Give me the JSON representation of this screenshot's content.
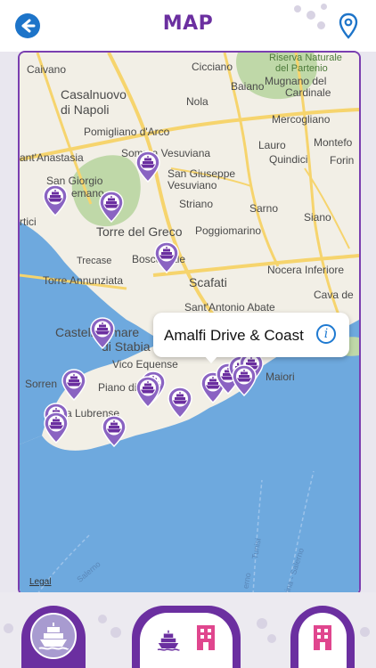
{
  "header": {
    "title": "MAP",
    "back_icon": "back-arrow-icon",
    "location_icon": "location-pin-icon"
  },
  "map": {
    "labels": {
      "caivano": "Caivano",
      "cicciano": "Cicciano",
      "riserva_partenio": "Riserva Naturale",
      "del_partenio": "del Partenio",
      "mugnano": "Mugnano del",
      "cardinale": "Cardinale",
      "casalnuovo": "Casalnuovo",
      "di_napoli": "di Napoli",
      "nola": "Nola",
      "baiano": "Baiano",
      "mercogliano": "Mercogliano",
      "pomigliano": "Pomigliano d'Arco",
      "somma": "Somma Vesuviana",
      "lauro": "Lauro",
      "montefo": "Montefo",
      "sant_anastasia": "ant'Anastasia",
      "quindici": "Quindici",
      "forin": "Forin",
      "san_giorgio": "San Giorgio",
      "cremano": "emano",
      "san_giuseppe": "San Giuseppe",
      "vesuviano": "Vesuviano",
      "ortici": "rtici",
      "striano": "Striano",
      "sarno": "Sarno",
      "siano": "Siano",
      "torre_greco": "Torre del Greco",
      "poggiomarino": "Poggiomarino",
      "trecase": "Trecase",
      "boscoreale": "Boscoreale",
      "nocera": "Nocera Inferiore",
      "torre_annunziata": "Torre Annunziata",
      "scafati": "Scafati",
      "cava": "Cava de",
      "sant_antonio_abate": "Sant'Antonio Abate",
      "castellammare": "Castellammare",
      "di_stabia": "di Stabia",
      "vico_equense": "Vico Equense",
      "sorrento": "Sorren",
      "piano": "Piano di So",
      "maiori": "Maiori",
      "massa": "ssa Lubrense",
      "route1": "Salerno",
      "route2": "Tunisi",
      "route3": "erno",
      "route4": "sina - Salerno"
    },
    "legal": "Legal",
    "callout": {
      "title": "Amalfi Drive & Coast",
      "info_icon": "info-icon"
    },
    "marker_icon": "ship-marker-icon"
  },
  "tabs": {
    "left_icon": "ship-icon",
    "middle_icons": [
      "ship-icon",
      "hotel-icon"
    ],
    "right_icon": "hotel-icon"
  },
  "colors": {
    "brand_purple": "#6b2fa0",
    "accent_blue": "#1d74c9",
    "sea": "#6ea9de",
    "land": "#f2efe6",
    "park": "#bfd8a8",
    "road": "#f6d46d",
    "hotel_pink": "#e0468e"
  }
}
